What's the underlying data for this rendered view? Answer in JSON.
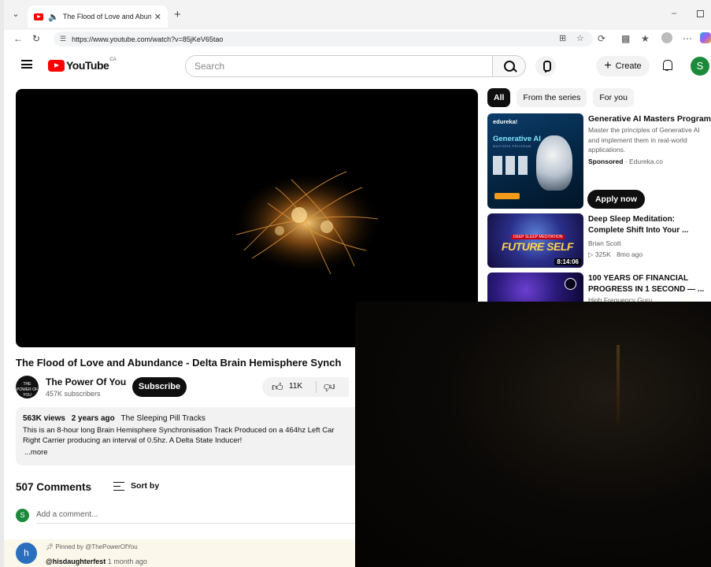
{
  "browser": {
    "tab_title": "The Flood of Love and Abund",
    "url": "https://www.youtube.com/watch?v=85jKeV65tao"
  },
  "header": {
    "logo_text": "YouTube",
    "region": "CA",
    "search_placeholder": "Search",
    "create_label": "Create",
    "avatar_letter": "S"
  },
  "video": {
    "title": "The Flood of Love and Abundance - Delta Brain Hemisphere Synch",
    "channel": "The Power Of You",
    "subscribers": "457K subscribers",
    "subscribe_label": "Subscribe",
    "likes": "11K",
    "channel_avatar_text": "THE POWER OF YOU"
  },
  "description": {
    "views": "563K views",
    "age": "2 years ago",
    "tagline": "The Sleeping Pill Tracks",
    "line1": "This is an 8-hour long Brain Hemisphere Synchronisation Track Produced on a 464hz Left Car",
    "line2": "Right Carrier producing an interval of 0.5hz.  A Delta State Inducer!",
    "more": "...more"
  },
  "comments": {
    "count": "507 Comments",
    "sort_label": "Sort by",
    "add_placeholder": "Add a comment...",
    "me_letter": "S",
    "pinned_label": "Pinned by @ThePowerOfYou",
    "first_author_letter": "h",
    "first_author": "@hisdaughterfest",
    "first_ago": "1 month ago"
  },
  "chips": [
    "All",
    "From the series",
    "For you"
  ],
  "ad": {
    "brand": "edureka!",
    "thumb_headline": "Generative AI",
    "thumb_sub": "MASTERS PROGRAM",
    "title": "Generative AI Masters Program",
    "description": "Master the principles of Generative AI and implement them in real-world applications.",
    "sponsored": "Sponsored",
    "domain": "Edureka.co",
    "cta": "Apply now"
  },
  "related": [
    {
      "title": "Deep Sleep Meditation: Complete Shift Into Your ...",
      "channel": "Brian Scott",
      "views": "325K",
      "age": "8mo ago",
      "duration": "8:14:06",
      "thumb_tag": "DEEP SLEEP MEDITATION",
      "thumb_text": "FUTURE SELF"
    },
    {
      "title": "100 YEARS OF FINANCIAL PROGRESS IN 1 SECOND — ...",
      "channel": "High Frequency Guru"
    }
  ],
  "colors": {
    "brand_red": "#ff0000",
    "avatar_green": "#1b8a3a",
    "chip_active": "#0f0f0f"
  }
}
